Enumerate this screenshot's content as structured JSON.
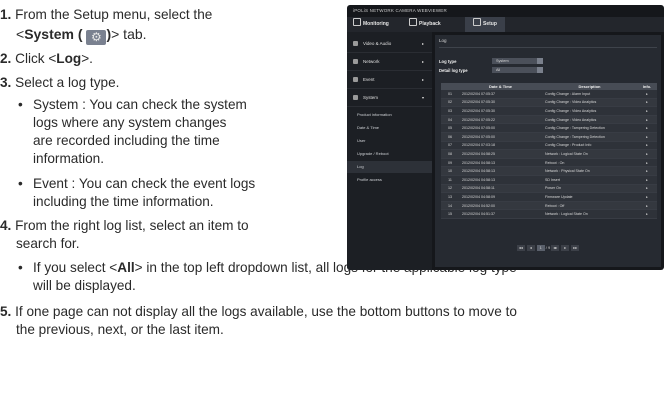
{
  "steps": [
    {
      "num": "1.",
      "pre": "From the Setup menu, select the",
      "line2_pre": "<",
      "line2_bold": "System (",
      "line2_mid": ")",
      "line2_post": "> tab.",
      "icon": "gear-icon"
    },
    {
      "num": "2.",
      "pre": "Click <",
      "bold": "Log",
      "post": ">."
    },
    {
      "num": "3.",
      "text": "Select a log type."
    },
    {
      "num": "4.",
      "line1": "From the right log list, select an item to",
      "line2": "search for."
    },
    {
      "num": "5.",
      "line1": "If one page can not display all the logs available, use the bottom buttons to move to",
      "line2": "the previous, next, or the last item."
    }
  ],
  "bullets_step3": [
    {
      "lines": [
        "System : You can check the system",
        "logs where any system changes",
        "are recorded including the time",
        "information."
      ]
    },
    {
      "lines": [
        "Event : You can check the event logs",
        "including the time information."
      ]
    }
  ],
  "bullet_step4": {
    "pre": "If you select <",
    "bold": "All",
    "post": "> in the top left dropdown list, all logs for the applicable log type",
    "line2": "will be displayed."
  },
  "screenshot": {
    "brand": "iPOLiS NETWORK CAMERA WEBVIEWER",
    "tabs": [
      "Monitoring",
      "Playback",
      "Setup"
    ],
    "menu": [
      {
        "label": "Video & Audio",
        "arrow": "▸"
      },
      {
        "label": "Network",
        "arrow": "▸"
      },
      {
        "label": "Event",
        "arrow": "▸"
      },
      {
        "label": "System",
        "arrow": "▾"
      }
    ],
    "submenu": [
      "Product information",
      "Date & Time",
      "User",
      "Upgrade / Reboot",
      "Log",
      "Profile access"
    ],
    "breadcrumb": "Log",
    "log_type_label": "Log type",
    "log_type_value": "System",
    "detail_label": "Detail log type",
    "detail_value": "All",
    "columns": [
      "",
      "Date & Time",
      "Description",
      "Info."
    ],
    "rows": [
      [
        "01",
        "2012/02/04 07:05:37",
        "Config Change : Alarm Input",
        "▸"
      ],
      [
        "02",
        "2012/02/04 07:05:30",
        "Config Change : Video Analytics",
        "▸"
      ],
      [
        "03",
        "2012/02/04 07:05:30",
        "Config Change : Video Analytics",
        "▸"
      ],
      [
        "04",
        "2012/02/04 07:05:22",
        "Config Change : Video Analytics",
        "▸"
      ],
      [
        "05",
        "2012/02/04 07:05:00",
        "Config Change : Tampering Detection",
        "▸"
      ],
      [
        "06",
        "2012/02/04 07:05:00",
        "Config Change : Tampering Detection",
        "▸"
      ],
      [
        "07",
        "2012/02/04 07:03:18",
        "Config Change : Product Info",
        "▸"
      ],
      [
        "08",
        "2012/02/04 04:58:25",
        "Network : Logical State On",
        "▸"
      ],
      [
        "09",
        "2012/02/04 04:58:13",
        "Reboot : On",
        "▸"
      ],
      [
        "10",
        "2012/02/04 04:58:13",
        "Network : Physical State On",
        "▸"
      ],
      [
        "11",
        "2012/02/04 04:58:13",
        "SD Insert",
        "▸"
      ],
      [
        "12",
        "2012/02/04 04:58:11",
        "Power On",
        "▸"
      ],
      [
        "13",
        "2012/02/04 04:58:09",
        "Firmware Update",
        "▸"
      ],
      [
        "14",
        "2012/02/04 04:52:00",
        "Reboot : Off",
        "▸"
      ],
      [
        "15",
        "2012/02/04 04:51:37",
        "Network : Logical State On",
        "▸"
      ]
    ],
    "pager": {
      "first": "◂◂",
      "prev": "◂",
      "current": "1",
      "sep": "/ 9",
      "go": "◂▸",
      "next": "▸",
      "last": "▸▸"
    }
  }
}
